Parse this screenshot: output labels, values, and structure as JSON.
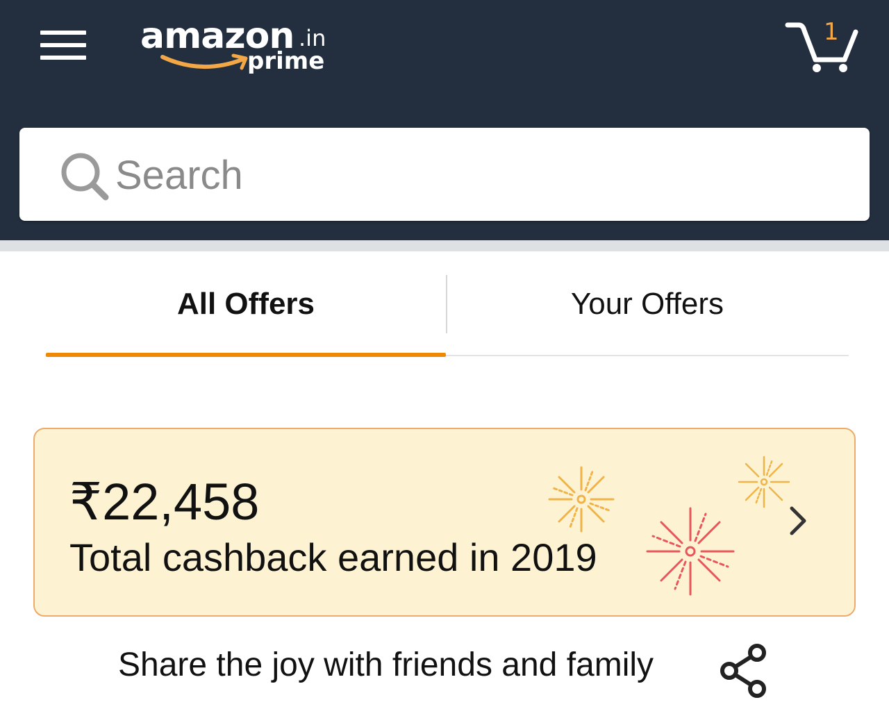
{
  "header": {
    "logo": {
      "word": "amazon",
      "tld": ".in",
      "sub": "prime"
    },
    "cart_count": "1",
    "menu_icon": "hamburger-menu-icon",
    "cart_icon": "shopping-cart-icon"
  },
  "search": {
    "placeholder": "Search",
    "icon": "search-icon"
  },
  "tabs": [
    {
      "label": "All Offers",
      "selected": true
    },
    {
      "label": "Your Offers",
      "selected": false
    }
  ],
  "cashback": {
    "amount": "₹22,458",
    "label": "Total cashback earned in 2019",
    "icons": [
      "firework-icon",
      "chevron-right-icon"
    ]
  },
  "share": {
    "label": "Share the joy with friends and family",
    "icon": "share-icon"
  },
  "colors": {
    "header_bg": "#232f3e",
    "accent": "#f08804",
    "card_bg": "#fdf3d3",
    "card_border": "#eeaa6a",
    "firework_red": "#e8555a",
    "firework_gold": "#f0b347"
  }
}
